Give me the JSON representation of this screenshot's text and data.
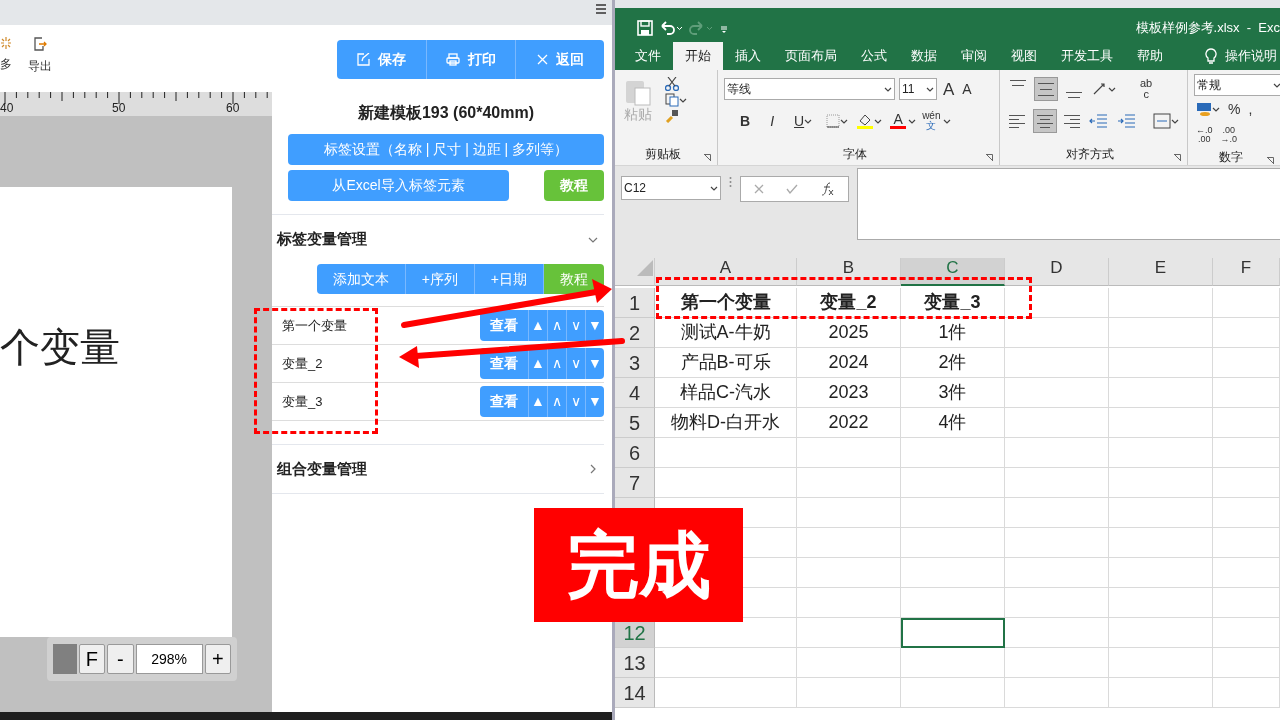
{
  "left_app": {
    "toolbar": [
      {
        "kind": "more",
        "label": "多"
      },
      {
        "kind": "export",
        "label": "导出"
      }
    ],
    "actions": [
      {
        "kind": "edit",
        "label": "保存"
      },
      {
        "kind": "print",
        "label": "打印"
      },
      {
        "kind": "close",
        "label": "返回"
      }
    ],
    "ruler": {
      "ticks": [
        "40",
        "50",
        "60"
      ]
    },
    "canvas_text": "个变量",
    "zoom": {
      "fit": "F",
      "minus": "-",
      "value": "298%",
      "plus": "+"
    },
    "title": "新建模板193 (60*40mm)",
    "settings_button": "标签设置（名称 | 尺寸 | 边距 | 多列等）",
    "import_button": "从Excel导入标签元素",
    "tutorial_button": "教程",
    "sections": [
      {
        "title": "标签变量管理",
        "expanded": true,
        "buttons": [
          {
            "label": "添加文本",
            "kind": "primary"
          },
          {
            "label": "+序列",
            "kind": "primary"
          },
          {
            "label": "+日期",
            "kind": "primary"
          },
          {
            "label": "教程",
            "kind": "success"
          }
        ],
        "variables": [
          {
            "name": "第一个变量",
            "actions": [
              "查看",
              "▲",
              "∧",
              "∨",
              "▼"
            ]
          },
          {
            "name": "变量_2",
            "actions": [
              "查看",
              "▲",
              "∧",
              "∨",
              "▼"
            ]
          },
          {
            "name": "变量_3",
            "actions": [
              "查看",
              "▲",
              "∧",
              "∨",
              "▼"
            ]
          }
        ]
      },
      {
        "title": "组合变量管理",
        "expanded": false
      }
    ]
  },
  "excel": {
    "title": "模板样例参考.xlsx  -  Exc",
    "tabs": [
      {
        "label": "文件",
        "selected": false
      },
      {
        "label": "开始",
        "selected": true
      },
      {
        "label": "插入",
        "selected": false
      },
      {
        "label": "页面布局",
        "selected": false
      },
      {
        "label": "公式",
        "selected": false
      },
      {
        "label": "数据",
        "selected": false
      },
      {
        "label": "审阅",
        "selected": false
      },
      {
        "label": "视图",
        "selected": false
      },
      {
        "label": "开发工具",
        "selected": false
      },
      {
        "label": "帮助",
        "selected": false
      }
    ],
    "tell_me": "操作说明",
    "clipboard": {
      "paste": "粘贴",
      "paste_disabled": true,
      "label": "剪贴板"
    },
    "font": {
      "name": "等线",
      "size": "11",
      "label": "字体",
      "sizers": [
        {
          "kind": "grow",
          "label": "A"
        },
        {
          "kind": "shrink",
          "label": "A"
        }
      ],
      "styles": [
        {
          "kind": "bold",
          "label": "B"
        },
        {
          "kind": "italic",
          "label": "I"
        },
        {
          "kind": "underline",
          "label": "U"
        }
      ],
      "font_color": "A",
      "phonetic": {
        "top": "wén",
        "bottom": "文"
      }
    },
    "alignment": {
      "label": "对齐方式",
      "wrap": {
        "top": "ab",
        "bottom": "c"
      },
      "buttons": [
        {
          "kind": "top",
          "selected": false
        },
        {
          "kind": "middle",
          "selected": true
        },
        {
          "kind": "bottom",
          "selected": false
        },
        {
          "kind": "left",
          "selected": false
        },
        {
          "kind": "center",
          "selected": true
        },
        {
          "kind": "right",
          "selected": false
        }
      ]
    },
    "number": {
      "format": "常规",
      "percent": "%",
      "comma": ",",
      "label": "数字",
      "decimals": [
        {
          "top": "←.0",
          "bottom": ".00"
        },
        {
          "top": ".00",
          "bottom": "→.0"
        }
      ]
    },
    "name_box": "C12",
    "columns": [
      {
        "label": "A",
        "selected": false
      },
      {
        "label": "B",
        "selected": false
      },
      {
        "label": "C",
        "selected": true
      },
      {
        "label": "D",
        "selected": false
      },
      {
        "label": "E",
        "selected": false
      },
      {
        "label": "F",
        "selected": false
      }
    ],
    "rows": [
      {
        "header": "1",
        "selected": false,
        "bold": true,
        "cells": [
          "第一个变量",
          "变量_2",
          "变量_3"
        ]
      },
      {
        "header": "2",
        "selected": false,
        "bold": false,
        "cells": [
          "测试A-牛奶",
          "2025",
          "1件"
        ]
      },
      {
        "header": "3",
        "selected": false,
        "bold": false,
        "cells": [
          "产品B-可乐",
          "2024",
          "2件"
        ]
      },
      {
        "header": "4",
        "selected": false,
        "bold": false,
        "cells": [
          "样品C-汽水",
          "2023",
          "3件"
        ]
      },
      {
        "header": "5",
        "selected": false,
        "bold": false,
        "cells": [
          "物料D-白开水",
          "2022",
          "4件"
        ]
      },
      {
        "header": "6",
        "selected": false
      },
      {
        "header": "7",
        "selected": false
      },
      {
        "covered": true
      },
      {
        "covered": true
      },
      {
        "covered": true
      },
      {
        "covered": true
      },
      {
        "header": "12",
        "selected": true
      },
      {
        "header": "13",
        "selected": false
      },
      {
        "header": "14",
        "selected": false
      }
    ]
  },
  "overlay": {
    "done_label": "完成"
  }
}
